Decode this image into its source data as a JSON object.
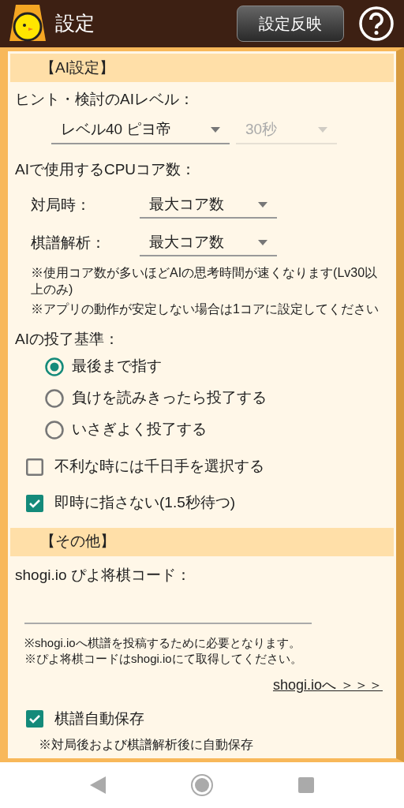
{
  "app_bar": {
    "title": "設定",
    "apply_button": "設定反映"
  },
  "sections": [
    {
      "heading": "【AI設定】"
    },
    {
      "heading": "【その他】"
    }
  ],
  "ai_level": {
    "label": "ヒント・検討のAIレベル：",
    "dropdowns": [
      {
        "value": "レベル40 ピヨ帝",
        "disabled": false
      },
      {
        "value": "30秒",
        "disabled": true
      }
    ]
  },
  "cpu_cores": {
    "label": "AIで使用するCPUコア数：",
    "rows": [
      {
        "label": "対局時：",
        "value": "最大コア数"
      },
      {
        "label": "棋譜解析：",
        "value": "最大コア数"
      }
    ],
    "notes": [
      "※使用コア数が多いほどAIの思考時間が速くなります(Lv30以上のみ)",
      "※アプリの動作が安定しない場合は1コアに設定してください"
    ]
  },
  "resign": {
    "label": "AIの投了基準：",
    "options": [
      {
        "label": "最後まで指す",
        "selected": true
      },
      {
        "label": "負けを読みきったら投了する",
        "selected": false
      },
      {
        "label": "いさぎよく投了する",
        "selected": false
      }
    ]
  },
  "ai_checks": [
    {
      "label": "不利な時には千日手を選択する",
      "checked": false
    },
    {
      "label": "即時に指さない(1.5秒待つ)",
      "checked": true
    }
  ],
  "code": {
    "label": "shogi.io ぴよ将棋コード：",
    "notes": [
      "※shogi.ioへ棋譜を投稿するために必要となります。",
      "※ぴよ将棋コードはshogi.ioにて取得してください。"
    ],
    "link": "shogi.ioへ ＞＞＞"
  },
  "autosave": {
    "label": "棋譜自動保存",
    "checked": true,
    "note": "※対局後および棋譜解析後に自動保存"
  }
}
